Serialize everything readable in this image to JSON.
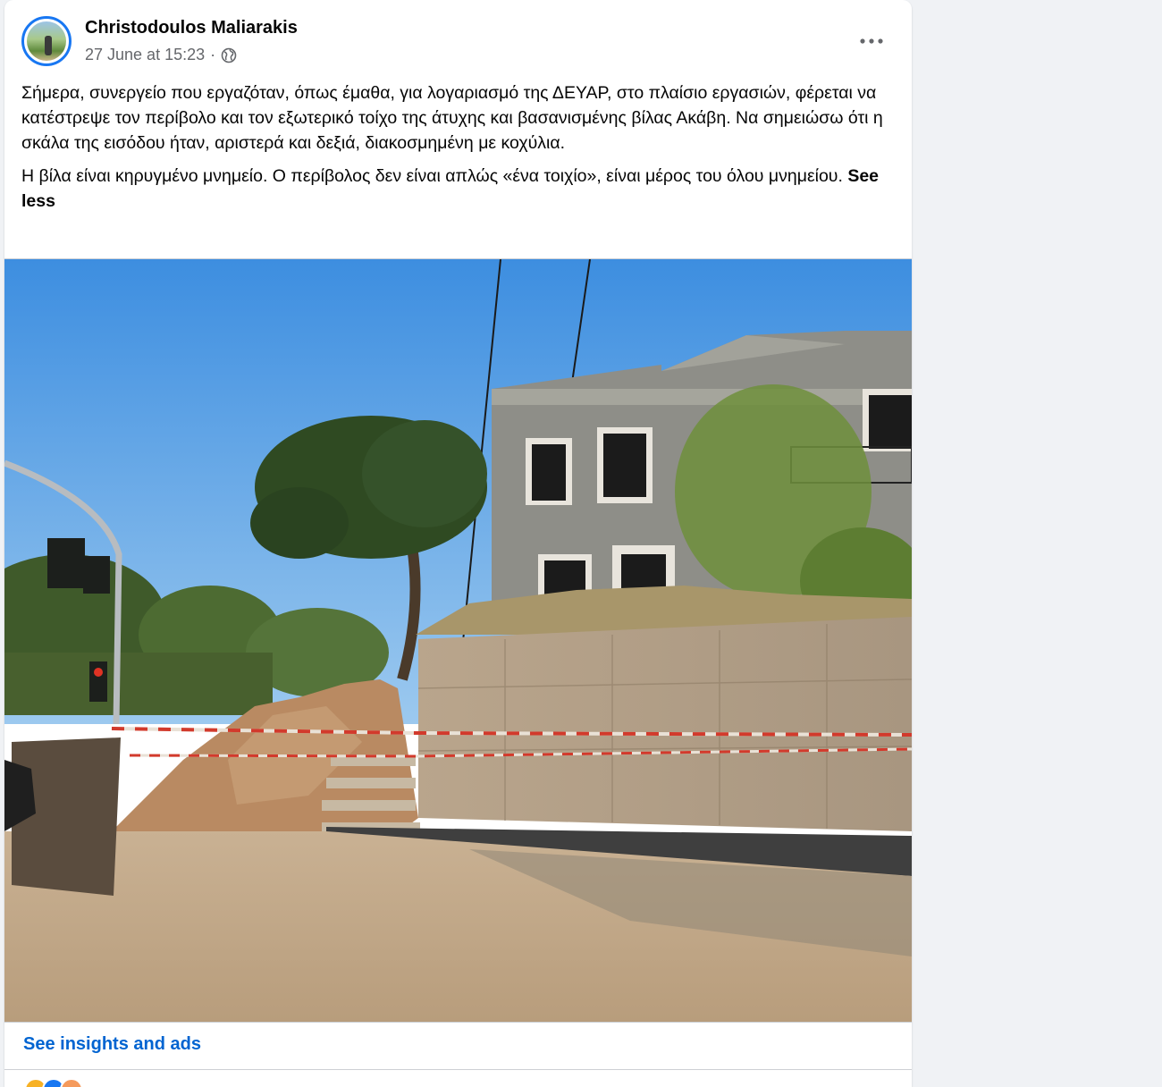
{
  "post": {
    "author": "Christodoulos Maliarakis",
    "timestamp": "27 June at 15:23",
    "separator": "·",
    "audience_icon": "globe-icon",
    "more_icon": "more-options-icon",
    "paragraph1": "Σήμερα, συνεργείο που εργαζόταν, όπως έμαθα, για λογαριασμό της ΔΕΥΑΡ, στο πλαίσιο εργασιών, φέρεται να κατέστρεψε τον περίβολο και τον εξωτερικό τοίχο της άτυχης και βασανισμένης βίλας Ακάβη. Να σημειώσω ότι η σκάλα της εισόδου ήταν, αριστερά και δεξιά, διακοσμημένη με κοχύλια.",
    "paragraph2": "Η βίλα είναι κηρυγμένο μνημείο. Ο περίβολος δεν είναι απλώς «ένα τοιχίο», είναι μέρος του όλου μνημείου.",
    "see_less": "See less"
  },
  "footer": {
    "insights_link": "See insights and ads"
  },
  "colors": {
    "link": "#0064d1",
    "secondary_text": "#65676b",
    "avatar_ring": "#1877f2",
    "sky": "#5a9fe0",
    "reaction_like": "#1877f2",
    "reaction_love": "#f33e58",
    "reaction_care": "#f7b125"
  }
}
